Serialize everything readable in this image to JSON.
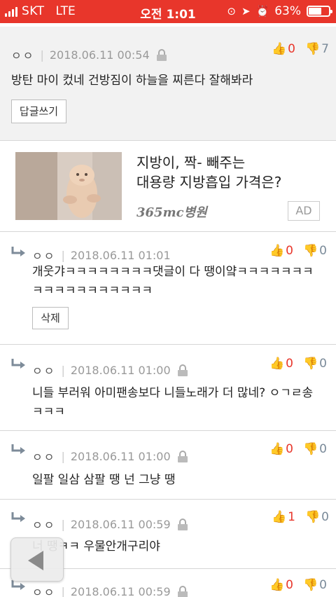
{
  "status_bar": {
    "carrier": "SKT",
    "network": "LTE",
    "time": "오전 1:01",
    "battery": "63%",
    "battery_level": 0.63
  },
  "top_comment": {
    "author": "ㅇㅇ",
    "date": "2018.06.11 00:54",
    "likes": "0",
    "dislikes": "7",
    "text": "방탄 마이 컸네 건방짐이 하늘을 찌른다 잘해봐라",
    "reply_button": "답글쓰기"
  },
  "ad": {
    "title_line1": "지방이, 짝- 빼주는",
    "title_line2": "대용량 지방흡입 가격은?",
    "brand": "365mc병원",
    "badge": "AD"
  },
  "replies": [
    {
      "author": "ㅇㅇ",
      "date": "2018.06.11 01:01",
      "likes": "0",
      "dislikes": "0",
      "text_line1": "개웃갸ㅋㅋㅋㅋㅋㅋㅋㅋ댓글이 다 땡이얔ㅋㅋㅋㅋㅋㅋㅋ",
      "text_line2": "ㅋㅋㅋㅋㅋㅋㅋㅋㅋㅋㅋ",
      "delete_button": "삭제"
    },
    {
      "author": "ㅇㅇ",
      "date": "2018.06.11 01:00",
      "likes": "0",
      "dislikes": "0",
      "text_line1": "니들 부러워 아미팬송보다 니들노래가 더 많네? ㅇㄱㄹ송",
      "text_line2": "ㅋㅋㅋ"
    },
    {
      "author": "ㅇㅇ",
      "date": "2018.06.11 01:00",
      "likes": "0",
      "dislikes": "0",
      "text_line1": "일팔 일삼 삼팔 땡 넌 그냥 땡"
    },
    {
      "author": "ㅇㅇ",
      "date": "2018.06.11 00:59",
      "likes": "1",
      "dislikes": "0",
      "text_line1": "너 땡ㅋㅋ 우물안개구리야"
    },
    {
      "author": "ㅇㅇ",
      "date": "2018.06.11 00:59",
      "likes": "0",
      "dislikes": "0"
    }
  ],
  "nav": {
    "back_icon": "back-arrow-icon"
  }
}
